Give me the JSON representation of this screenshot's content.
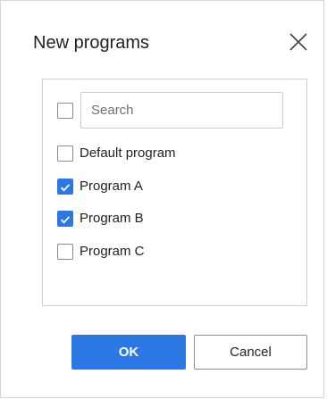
{
  "dialog": {
    "title": "New programs",
    "close_icon": "close-icon"
  },
  "search": {
    "placeholder": "Search",
    "value": "",
    "select_all_checked": false
  },
  "items": [
    {
      "label": "Default program",
      "checked": false
    },
    {
      "label": "Program A",
      "checked": true
    },
    {
      "label": "Program B",
      "checked": true
    },
    {
      "label": "Program C",
      "checked": false
    }
  ],
  "buttons": {
    "ok_label": "OK",
    "cancel_label": "Cancel"
  },
  "colors": {
    "accent": "#2b78e4",
    "border": "#cfcfcf",
    "text": "#222222"
  }
}
